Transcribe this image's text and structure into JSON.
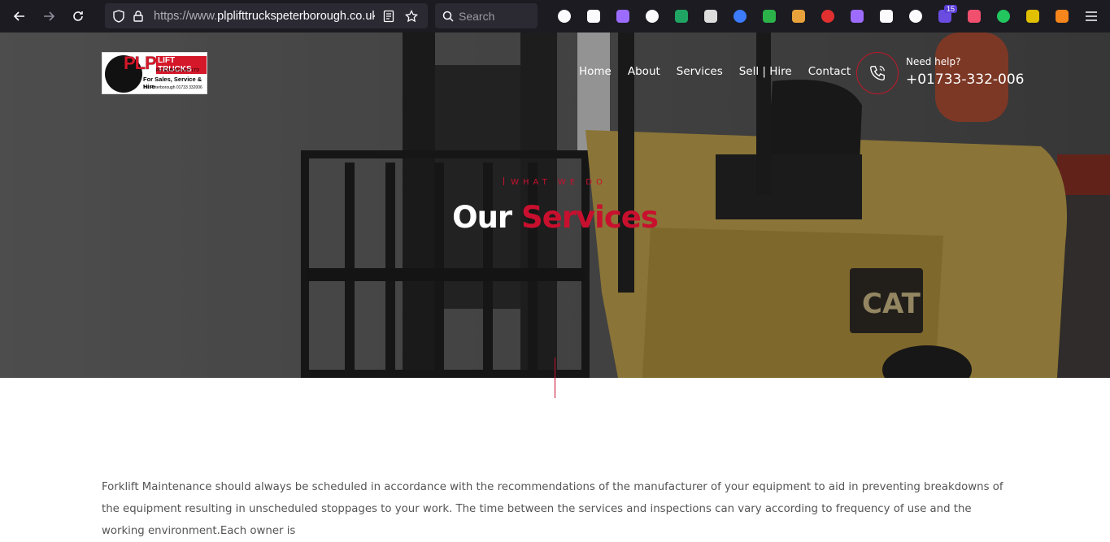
{
  "browser": {
    "url_prefix": "https://www.",
    "url_domain": "plplifttruckspeterborough.co.uk",
    "url_suffix": "/",
    "search_placeholder": "Search",
    "extensions": [
      {
        "name": "pocket-icon",
        "color": "#fbfbfe"
      },
      {
        "name": "wrench-icon",
        "color": "#fbfbfe"
      },
      {
        "name": "ghost-icon",
        "color": "#9b6cff"
      },
      {
        "name": "puzzle-icon",
        "color": "#fbfbfe"
      },
      {
        "name": "globe-icon",
        "color": "#1fa463"
      },
      {
        "name": "cloud-icon",
        "color": "#dddddd"
      },
      {
        "name": "translate-icon",
        "color": "#3d7bfd"
      },
      {
        "name": "money-icon",
        "color": "#2bb34a"
      },
      {
        "name": "broom-icon",
        "color": "#e9a23b"
      },
      {
        "name": "hand-icon",
        "color": "#e23030"
      },
      {
        "name": "gear-icon",
        "color": "#9d6bff"
      },
      {
        "name": "cookie-icon",
        "color": "#fbfbfe"
      },
      {
        "name": "react-icon",
        "color": "#fbfbfe"
      },
      {
        "name": "shield-icon",
        "color": "#6a4ce0",
        "badge": "15"
      },
      {
        "name": "fwa-icon",
        "color": "#f0506e"
      },
      {
        "name": "sync-icon",
        "color": "#22c55e"
      },
      {
        "name": "json-icon",
        "color": "#e0c000"
      },
      {
        "name": "fox-icon",
        "color": "#f6851b"
      }
    ]
  },
  "site": {
    "logo": {
      "plp": "PLP",
      "lift": "LIFT TRUCKS",
      "sub": "PETERBOROUGH LTD",
      "tagline": "For Sales, Service & Hire",
      "tel": "Tel: Peterborough 01733 332006"
    },
    "nav": [
      "Home",
      "About",
      "Services",
      "Sell | Hire",
      "Contact"
    ],
    "help_label": "Need help?",
    "phone": "+01733-332-006",
    "eyebrow": "WHAT WE DO",
    "title_white": "Our",
    "title_red": "Services",
    "paragraph": "Forklift Maintenance should always be scheduled in accordance with the recommendations of the manufacturer of your equipment to aid in preventing breakdowns of the equipment resulting in unscheduled stoppages to your work. The time between the services and inspections can vary according to frequency of use and the working environment.Each owner is"
  },
  "colors": {
    "accent": "#c8102e",
    "chrome": "#1c1b22",
    "forklift_yellow": "#c9a84a"
  }
}
